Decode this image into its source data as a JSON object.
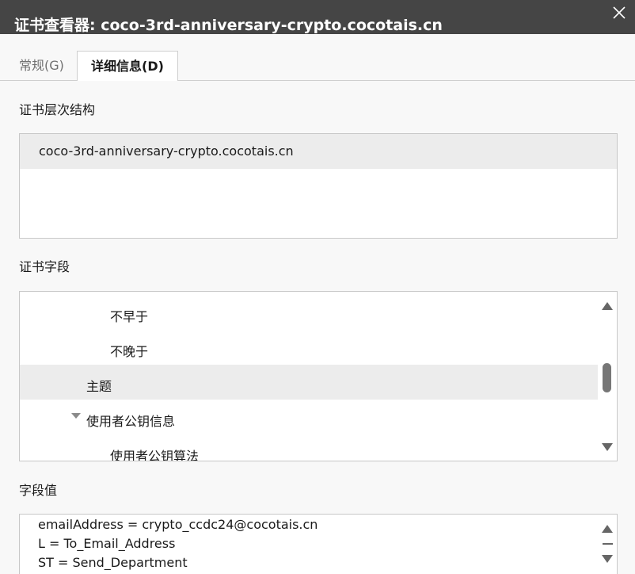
{
  "window": {
    "title": "证书查看器: coco-3rd-anniversary-crypto.cocotais.cn",
    "close_icon": "close-icon"
  },
  "tabs": [
    {
      "label": "常规(G)",
      "selected": false
    },
    {
      "label": "详细信息(D)",
      "selected": true
    }
  ],
  "hierarchy": {
    "label": "证书层次结构",
    "items": [
      "coco-3rd-anniversary-crypto.cocotais.cn"
    ]
  },
  "fields": {
    "label": "证书字段",
    "items": [
      {
        "label": "不早于"
      },
      {
        "label": "不晚于"
      },
      {
        "label": "主题",
        "selected": true
      },
      {
        "label": "使用者公钥信息",
        "expanded": true
      },
      {
        "label": "使用者公钥算法"
      }
    ]
  },
  "field_value": {
    "label": "字段值",
    "lines": [
      "emailAddress = crypto_ccdc24@cocotais.cn",
      "L = To_Email_Address",
      "ST = Send_Department"
    ]
  },
  "colors": {
    "titlebar_bg": "#454545",
    "selected_row_bg": "#ececec",
    "scroll_thumb": "#767676"
  }
}
